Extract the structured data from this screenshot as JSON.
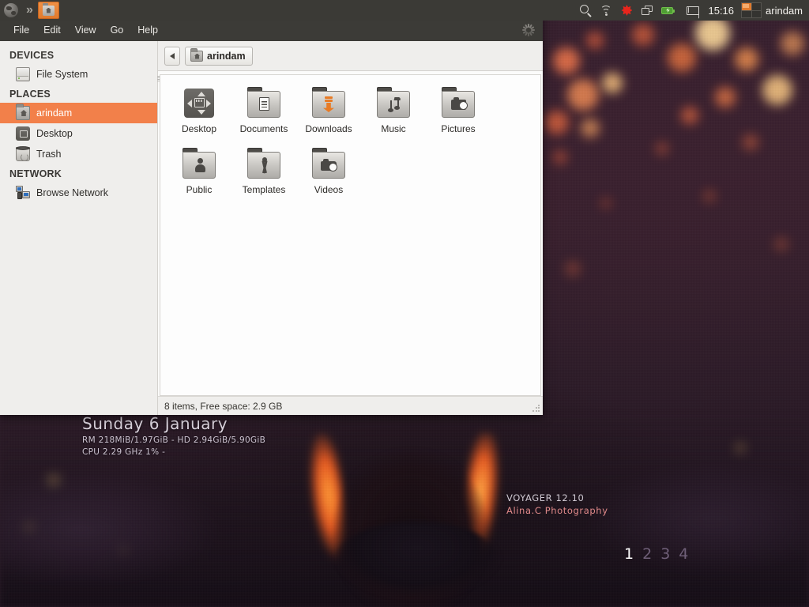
{
  "panel": {
    "left_items": [
      {
        "name": "globe-icon",
        "label": "Web Browser"
      },
      {
        "name": "chevron-double-icon",
        "label": "»"
      },
      {
        "name": "taskbar-file-manager",
        "label": "arindam - File Manager"
      }
    ],
    "tray": [
      {
        "name": "search-icon",
        "label": "Search"
      },
      {
        "name": "wifi-icon",
        "label": "Network"
      },
      {
        "name": "updates-icon",
        "label": "Updates"
      },
      {
        "name": "windows-icon",
        "label": "Windows"
      },
      {
        "name": "battery-icon",
        "label": "Battery"
      },
      {
        "name": "mail-icon",
        "label": "Mail"
      }
    ],
    "clock": "15:16",
    "workspaces": [
      "1",
      "2",
      "3",
      "4"
    ],
    "active_workspace": "1",
    "user": "arindam",
    "accent_color": "#e07a2d",
    "panel_bg": "#3b3a36"
  },
  "window": {
    "title": "arindam - File Manager",
    "menu": [
      "File",
      "Edit",
      "View",
      "Go",
      "Help"
    ],
    "sidebar": {
      "groups": [
        {
          "header": "DEVICES",
          "items": [
            {
              "label": "File System",
              "icon": "drive-icon",
              "selected": false
            }
          ]
        },
        {
          "header": "PLACES",
          "items": [
            {
              "label": "arindam",
              "icon": "home-folder-icon",
              "selected": true
            },
            {
              "label": "Desktop",
              "icon": "desktop-icon",
              "selected": false
            },
            {
              "label": "Trash",
              "icon": "trash-icon",
              "selected": false
            }
          ]
        },
        {
          "header": "NETWORK",
          "items": [
            {
              "label": "Browse Network",
              "icon": "network-icon",
              "selected": false
            }
          ]
        }
      ],
      "selected_color": "#f2804a"
    },
    "pathbar": {
      "back_label": "Back",
      "crumb": "arindam"
    },
    "files": [
      {
        "label": "Desktop",
        "icon": "desktop-folder-icon"
      },
      {
        "label": "Documents",
        "icon": "documents-folder-icon"
      },
      {
        "label": "Downloads",
        "icon": "downloads-folder-icon"
      },
      {
        "label": "Music",
        "icon": "music-folder-icon"
      },
      {
        "label": "Pictures",
        "icon": "pictures-folder-icon"
      },
      {
        "label": "Public",
        "icon": "public-folder-icon"
      },
      {
        "label": "Templates",
        "icon": "templates-folder-icon"
      },
      {
        "label": "Videos",
        "icon": "videos-folder-icon"
      }
    ],
    "statusbar": "8 items, Free space: 2.9 GB"
  },
  "desktop": {
    "conky": {
      "date": "Sunday  6 January",
      "line2": "RM 218MiB/1.97GiB - HD 2.94GiB/5.90GiB",
      "line3": "CPU 2.29 GHz 1% -"
    },
    "credit": {
      "line1": "VOYAGER 12.10",
      "line2": "Alina.C Photography"
    },
    "pager": [
      "1",
      "2",
      "3",
      "4"
    ],
    "pager_active": "1"
  }
}
